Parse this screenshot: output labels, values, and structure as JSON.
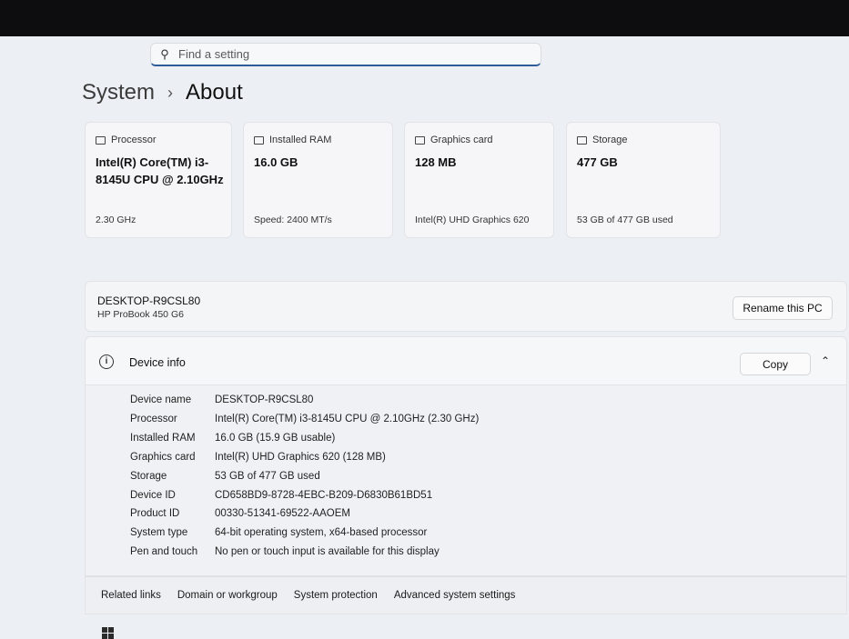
{
  "search": {
    "placeholder": "Find a setting"
  },
  "breadcrumb": {
    "parent": "System",
    "current": "About"
  },
  "cards": [
    {
      "label": "Processor",
      "value": "Intel(R) Core(TM) i3-8145U CPU @ 2.10GHz",
      "sub": "2.30 GHz"
    },
    {
      "label": "Installed RAM",
      "value": "16.0 GB",
      "sub": "Speed: 2400 MT/s"
    },
    {
      "label": "Graphics card",
      "value": "128 MB",
      "sub": "Intel(R) UHD Graphics 620"
    },
    {
      "label": "Storage",
      "value": "477 GB",
      "sub": "53 GB of 477 GB used"
    }
  ],
  "pc": {
    "name": "DESKTOP-R9CSL80",
    "model": "HP ProBook 450 G6",
    "rename_label": "Rename this PC"
  },
  "device_info": {
    "title": "Device info",
    "copy_label": "Copy",
    "specs": [
      {
        "label": "Device name",
        "value": "DESKTOP-R9CSL80"
      },
      {
        "label": "Processor",
        "value": "Intel(R) Core(TM) i3-8145U CPU @ 2.10GHz (2.30 GHz)"
      },
      {
        "label": "Installed RAM",
        "value": "16.0 GB (15.9 GB usable)"
      },
      {
        "label": "Graphics card",
        "value": "Intel(R) UHD Graphics 620 (128 MB)"
      },
      {
        "label": "Storage",
        "value": "53 GB of 477 GB used"
      },
      {
        "label": "Device ID",
        "value": "CD658BD9-8728-4EBC-B209-D6830B61BD51"
      },
      {
        "label": "Product ID",
        "value": "00330-51341-69522-AAOEM"
      },
      {
        "label": "System type",
        "value": "64-bit operating system, x64-based processor"
      },
      {
        "label": "Pen and touch",
        "value": "No pen or touch input is available for this display"
      }
    ]
  },
  "related_links": {
    "label": "Related links",
    "items": [
      "Domain or workgroup",
      "System protection",
      "Advanced system settings"
    ]
  }
}
